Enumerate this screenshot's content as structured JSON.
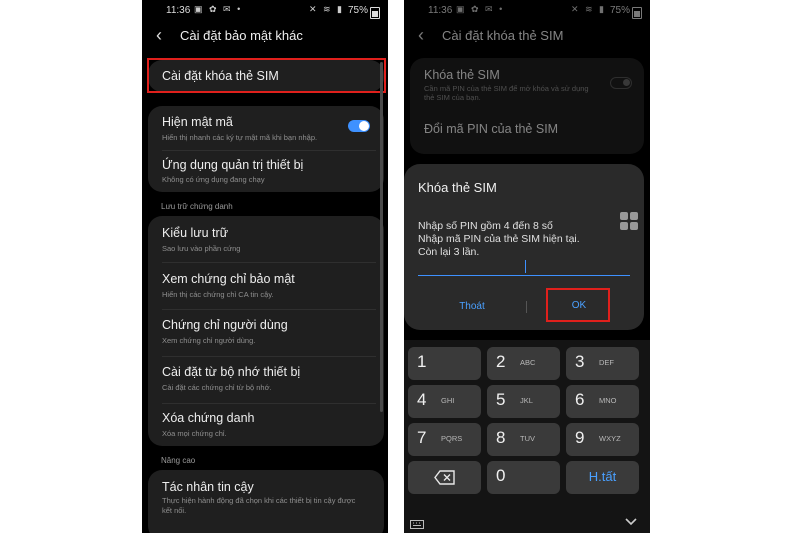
{
  "colors": {
    "accent": "#3e91ff",
    "highlight": "#e0201c",
    "background": "#000000",
    "card": "#1f1f1f"
  },
  "left_screen": {
    "status": {
      "time": "11:36",
      "left_icons": "▣ ✿ ✉ •",
      "right_icons": "✕ ≋ ▮",
      "battery": "75%"
    },
    "back_icon": "back-arrow-icon",
    "title": "Cài đặt bảo mật khác",
    "sim_lock_item": "Cài đặt khóa thẻ SIM",
    "show_password": {
      "title": "Hiện mật mã",
      "subtitle": "Hiển thị nhanh các ký tự mật mã khi bạn nhập.",
      "toggle": "on"
    },
    "device_admin": {
      "title": "Ứng dụng quản trị thiết bị",
      "subtitle": "Không có ứng dụng đang chạy"
    },
    "credential_storage_header": "Lưu trữ chứng danh",
    "storage_type": {
      "title": "Kiểu lưu trữ",
      "subtitle": "Sao lưu vào phần cứng"
    },
    "view_certs": {
      "title": "Xem chứng chỉ bảo mật",
      "subtitle": "Hiển thị các chứng chỉ CA tin cậy."
    },
    "user_certs": {
      "title": "Chứng chỉ người dùng",
      "subtitle": "Xem chứng chỉ người dùng."
    },
    "install_from_storage": {
      "title": "Cài đặt từ bộ nhớ thiết bị",
      "subtitle": "Cài đặt các chứng chỉ từ bộ nhớ."
    },
    "clear_credentials": {
      "title": "Xóa chứng danh",
      "subtitle": "Xóa mọi chứng chỉ."
    },
    "advanced_header": "Nâng cao",
    "trust_agents": {
      "title": "Tác nhân tin cậy",
      "subtitle_line1": "Thực hiện hành động đã chọn khi các thiết bị tin cậy được",
      "subtitle_line2": "kết nối."
    }
  },
  "right_screen": {
    "status": {
      "time": "11:36",
      "left_icons": "▣ ✿ ✉ •",
      "right_icons": "✕ ≋ ▮",
      "battery": "75%"
    },
    "title": "Cài đặt khóa thẻ SIM",
    "sim_lock": {
      "title": "Khóa thẻ SIM",
      "subtitle_line1": "Cần mã PIN của thẻ SIM để mở khóa và sử dụng",
      "subtitle_line2": "thẻ SIM của bạn.",
      "toggle": "off"
    },
    "change_pin": "Đổi mã PIN của thẻ SIM",
    "dialog": {
      "title": "Khóa thẻ SIM",
      "line1": "Nhập số PIN gồm 4 đến 8 số",
      "line2": "Nhập mã PIN của thẻ SIM hiện tại.",
      "line3": "Còn lại 3 lần.",
      "cancel": "Thoát",
      "ok": "OK"
    },
    "keypad": {
      "keys": [
        {
          "num": "1",
          "letters": ""
        },
        {
          "num": "2",
          "letters": "ABC"
        },
        {
          "num": "3",
          "letters": "DEF"
        },
        {
          "num": "4",
          "letters": "GHI"
        },
        {
          "num": "5",
          "letters": "JKL"
        },
        {
          "num": "6",
          "letters": "MNO"
        },
        {
          "num": "7",
          "letters": "PQRS"
        },
        {
          "num": "8",
          "letters": "TUV"
        },
        {
          "num": "9",
          "letters": "WXYZ"
        },
        {
          "num": "0",
          "letters": ""
        }
      ],
      "backspace_icon": "backspace-icon",
      "done": "H.tất",
      "keyboard_icon": "keyboard-icon",
      "hide_icon": "chevron-down-icon"
    }
  }
}
